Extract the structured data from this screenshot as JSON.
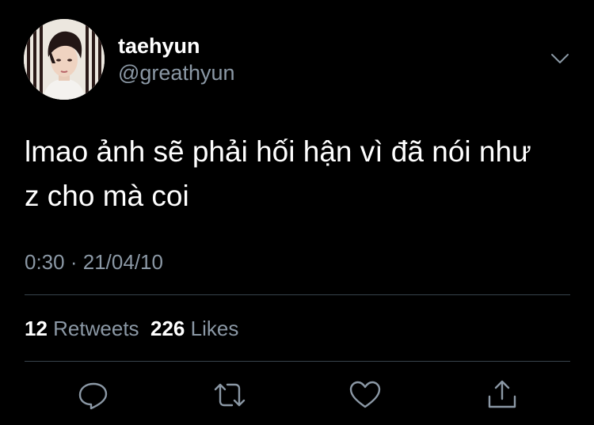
{
  "user": {
    "display_name": "taehyun",
    "handle": "@greathyun"
  },
  "tweet": {
    "text_line1": "lmao ảnh sẽ phải hối hận vì đã nói như",
    "text_line2": "z cho mà coi",
    "time": "0:30",
    "separator": "·",
    "date": "21/04/10"
  },
  "stats": {
    "retweets_count": "12",
    "retweets_label": "Retweets",
    "likes_count": "226",
    "likes_label": "Likes"
  },
  "icons": {
    "menu": "chevron-down-icon",
    "reply": "reply-icon",
    "retweet": "retweet-icon",
    "like": "like-icon",
    "share": "share-icon"
  },
  "colors": {
    "background": "#000000",
    "text": "#ffffff",
    "secondary_text": "#8b98a5",
    "divider": "#38444d"
  }
}
